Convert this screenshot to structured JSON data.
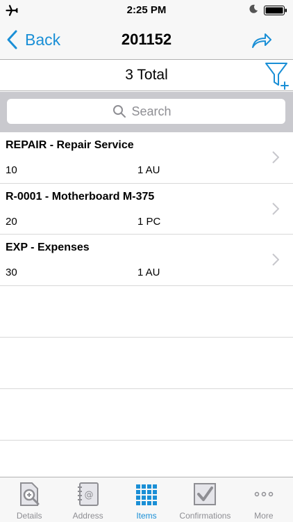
{
  "status_bar": {
    "time": "2:25 PM"
  },
  "nav": {
    "back_label": "Back",
    "title": "201152"
  },
  "total": {
    "text": "3 Total"
  },
  "search": {
    "placeholder": "Search"
  },
  "items": [
    {
      "title": "REPAIR - Repair Service",
      "position": "10",
      "quantity": "1 AU"
    },
    {
      "title": "R-0001 - Motherboard M-375",
      "position": "20",
      "quantity": "1 PC"
    },
    {
      "title": "EXP - Expenses",
      "position": "30",
      "quantity": "1 AU"
    }
  ],
  "tabs": [
    {
      "label": "Details",
      "icon": "details-icon",
      "active": false
    },
    {
      "label": "Address",
      "icon": "address-book-icon",
      "active": false
    },
    {
      "label": "Items",
      "icon": "items-grid-icon",
      "active": true
    },
    {
      "label": "Confirmations",
      "icon": "checkbox-icon",
      "active": false
    },
    {
      "label": "More",
      "icon": "more-dots-icon",
      "active": false
    }
  ],
  "colors": {
    "accent": "#1a8fd6",
    "inactive": "#8e8e93",
    "bar_bg": "#f7f7f7"
  }
}
